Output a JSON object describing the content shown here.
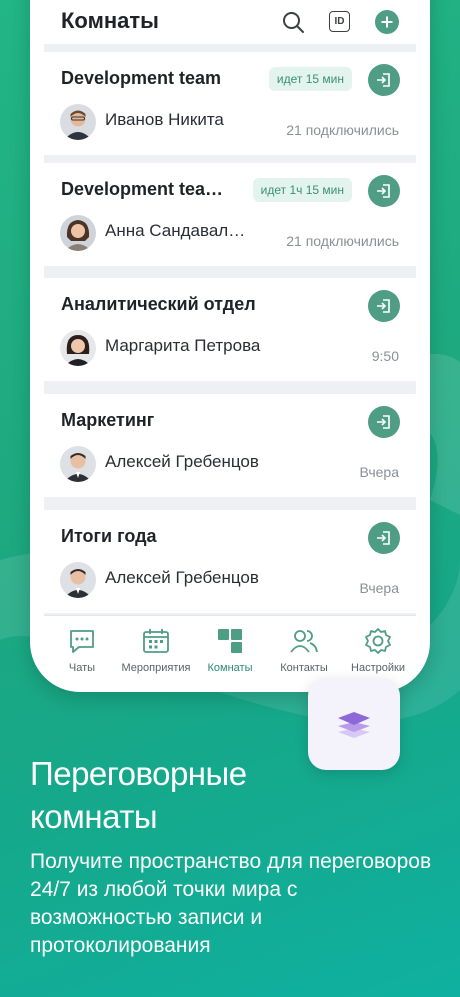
{
  "header": {
    "title": "Комнаты"
  },
  "rooms": [
    {
      "name": "Development team",
      "badge": "идет 15 мин",
      "host": "Иванов Никита",
      "meta": "21 подключились"
    },
    {
      "name": "Development tea…",
      "badge": "идет 1ч 15 мин",
      "host": "Анна Сандавал…",
      "meta": "21 подключились"
    },
    {
      "name": "Аналитический отдел",
      "badge": "",
      "host": "Маргарита Петрова",
      "meta": "9:50"
    },
    {
      "name": "Маркетинг",
      "badge": "",
      "host": "Алексей Гребенцов",
      "meta": "Вчера"
    },
    {
      "name": "Итоги года",
      "badge": "",
      "host": "Алексей Гребенцов",
      "meta": "Вчера"
    }
  ],
  "tabs": [
    {
      "label": "Чаты",
      "icon": "chat-icon"
    },
    {
      "label": "Мероприятия",
      "icon": "calendar-icon"
    },
    {
      "label": "Комнаты",
      "icon": "rooms-icon"
    },
    {
      "label": "Контакты",
      "icon": "contacts-icon"
    },
    {
      "label": "Настройки",
      "icon": "gear-icon"
    }
  ],
  "active_tab": "Комнаты",
  "id_icon_text": "ID",
  "promo": {
    "headline_line1": "Переговорные",
    "headline_line2": "комнаты",
    "description": "Получите пространство для переговоров 24/7 из любой точки мира с возможностью записи и протоколирования"
  },
  "colors": {
    "accent": "#4f9d85",
    "badge_bg": "#e3f4ee",
    "background": "#1ea97f"
  }
}
